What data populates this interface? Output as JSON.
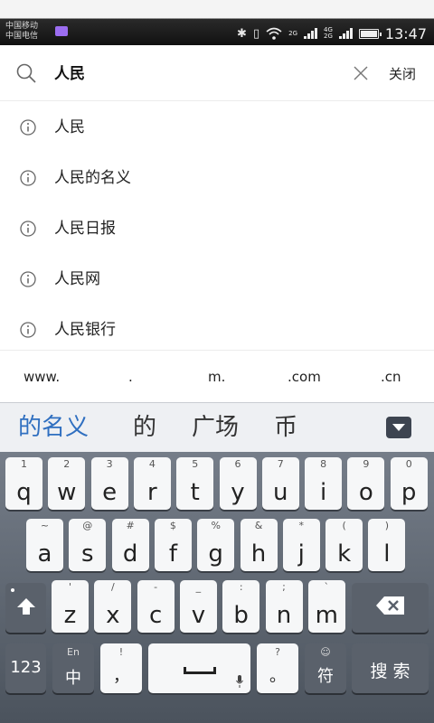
{
  "status_bar": {
    "carrier1": "中国移动",
    "carrier2": "中国电信",
    "net1": "2G",
    "net2": "4G",
    "net3": "2G",
    "time": "13:47"
  },
  "search": {
    "query": "人民",
    "close_label": "关闭"
  },
  "suggestions": [
    {
      "label": "人民"
    },
    {
      "label": "人民的名义"
    },
    {
      "label": "人民日报"
    },
    {
      "label": "人民网"
    },
    {
      "label": "人民银行"
    }
  ],
  "domain_shortcuts": [
    "www.",
    ".",
    "m.",
    ".com",
    ".cn"
  ],
  "keyboard": {
    "candidates": [
      "的名义",
      "的",
      "广场",
      "币"
    ],
    "row1": [
      {
        "main": "q",
        "sub": "1"
      },
      {
        "main": "w",
        "sub": "2"
      },
      {
        "main": "e",
        "sub": "3"
      },
      {
        "main": "r",
        "sub": "4"
      },
      {
        "main": "t",
        "sub": "5"
      },
      {
        "main": "y",
        "sub": "6"
      },
      {
        "main": "u",
        "sub": "7"
      },
      {
        "main": "i",
        "sub": "8"
      },
      {
        "main": "o",
        "sub": "9"
      },
      {
        "main": "p",
        "sub": "0"
      }
    ],
    "row2": [
      {
        "main": "a",
        "sub": "~"
      },
      {
        "main": "s",
        "sub": "@"
      },
      {
        "main": "d",
        "sub": "#"
      },
      {
        "main": "f",
        "sub": "$"
      },
      {
        "main": "g",
        "sub": "%"
      },
      {
        "main": "h",
        "sub": "&"
      },
      {
        "main": "j",
        "sub": "*"
      },
      {
        "main": "k",
        "sub": "("
      },
      {
        "main": "l",
        "sub": ")"
      }
    ],
    "row3": [
      {
        "main": "z",
        "sub": "'"
      },
      {
        "main": "x",
        "sub": "/"
      },
      {
        "main": "c",
        "sub": "-"
      },
      {
        "main": "v",
        "sub": "_"
      },
      {
        "main": "b",
        "sub": ":"
      },
      {
        "main": "n",
        "sub": ";"
      },
      {
        "main": "m",
        "sub": "`"
      }
    ],
    "num_key": "123",
    "lang_sub": "En",
    "lang_main": "中",
    "comma_sub": "!",
    "comma_main": "，",
    "period_sub": "?",
    "period_main": "。",
    "symbol_sub": "☺",
    "symbol_main": "符",
    "search_key": "搜 索"
  }
}
